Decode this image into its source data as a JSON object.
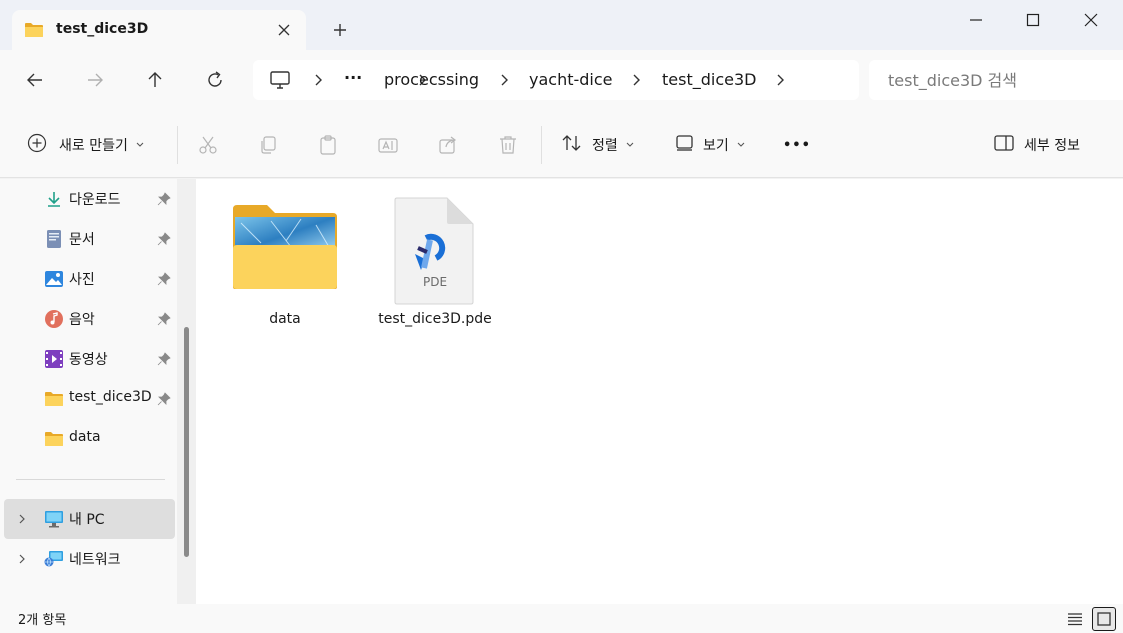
{
  "tab": {
    "title": "test_dice3D"
  },
  "window": {
    "new_tab": "+",
    "minimize": "minimize",
    "maximize": "maximize",
    "close": "close"
  },
  "breadcrumb": {
    "overflow": "···",
    "items": [
      "procecssing",
      "yacht-dice",
      "test_dice3D"
    ]
  },
  "search": {
    "placeholder": "test_dice3D 검색"
  },
  "commands": {
    "new": "새로 만들기",
    "sort": "정렬",
    "view": "보기",
    "more": "•••",
    "details": "세부 정보"
  },
  "navigation": {
    "quick_access": [
      {
        "label": "다운로드",
        "icon": "download-icon",
        "pinned": true
      },
      {
        "label": "문서",
        "icon": "document-icon",
        "pinned": true
      },
      {
        "label": "사진",
        "icon": "pictures-icon",
        "pinned": true
      },
      {
        "label": "음악",
        "icon": "music-icon",
        "pinned": true
      },
      {
        "label": "동영상",
        "icon": "video-icon",
        "pinned": true
      },
      {
        "label": "test_dice3D",
        "icon": "folder-icon",
        "pinned": true
      },
      {
        "label": "data",
        "icon": "folder-icon",
        "pinned": false
      }
    ],
    "tree": [
      {
        "label": "내 PC",
        "icon": "computer-icon",
        "selected": true
      },
      {
        "label": "네트워크",
        "icon": "network-icon",
        "selected": false
      }
    ]
  },
  "files": [
    {
      "name": "data",
      "type": "folder"
    },
    {
      "name": "test_dice3D.pde",
      "type": "pde",
      "badge": "PDE"
    }
  ],
  "status": {
    "count": "2개 항목"
  },
  "colors": {
    "accent": "#0067c0",
    "folder_yellow": "#f4c24a",
    "selected_bg": "#dedede",
    "content_bg": "#ffffff"
  }
}
